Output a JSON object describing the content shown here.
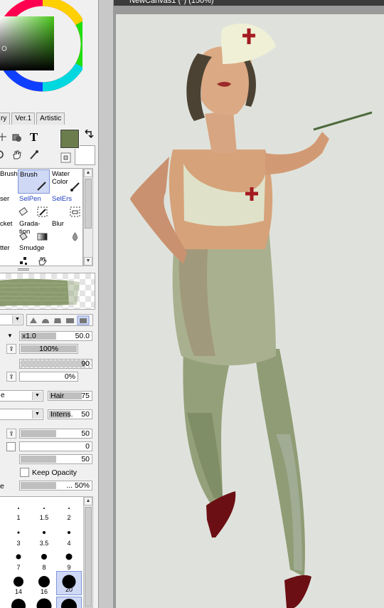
{
  "canvas": {
    "title": "NewCanvas1 (*) (150%)"
  },
  "color": {
    "foreground": "#6b7d4c",
    "background": "#ffffff"
  },
  "tabs": [
    "ry",
    "Ver.1",
    "Artistic"
  ],
  "tools": {
    "text_tool_glyph": "T",
    "icons": [
      "wand-icon",
      "bucket-icon",
      "text-icon",
      "zoom-icon",
      "hand-icon",
      "eyedropper-icon",
      "swap-arrow-icon",
      "reset-color-icon"
    ]
  },
  "brushes": [
    {
      "label": "Brush",
      "icon": "brush-icon"
    },
    {
      "label": "Brush",
      "icon": "brush-icon"
    },
    {
      "label": "Water Color",
      "icon": "watercolor-brush-icon"
    },
    {
      "label": "ser",
      "icon": "eraser-icon"
    },
    {
      "label": "SelPen",
      "icon": "selpen-icon"
    },
    {
      "label": "SelErs",
      "icon": "selers-icon"
    },
    {
      "label": "cket",
      "icon": "bucket-icon"
    },
    {
      "label": "Grada-tion",
      "icon": "gradation-icon"
    },
    {
      "label": "Blur",
      "icon": "blur-icon"
    },
    {
      "label": "tter",
      "icon": "scatter-icon"
    },
    {
      "label": "Smudge",
      "icon": "smudge-icon"
    }
  ],
  "brush_settings": {
    "size_multiplier": "x1.0",
    "size": "50.0",
    "min_size": "100%",
    "density": "90",
    "min_density": "0%",
    "texture": {
      "name": "Hair",
      "value": "75"
    },
    "blending": {
      "name": "Intens.",
      "value": "50"
    },
    "blending_pct": 50,
    "dilution_value": "50",
    "persistence_value": "0",
    "persistence_pct": 0,
    "extra_value": "50",
    "keep_opacity_label": "Keep Opacity",
    "keep_opacity_checked": false,
    "last_label": "e",
    "last_value": "... 50%",
    "partial_label": "e"
  },
  "brush_sizes": [
    "1",
    "1.5",
    "2",
    "3",
    "3.5",
    "4",
    "7",
    "8",
    "9",
    "14",
    "16",
    "20"
  ]
}
